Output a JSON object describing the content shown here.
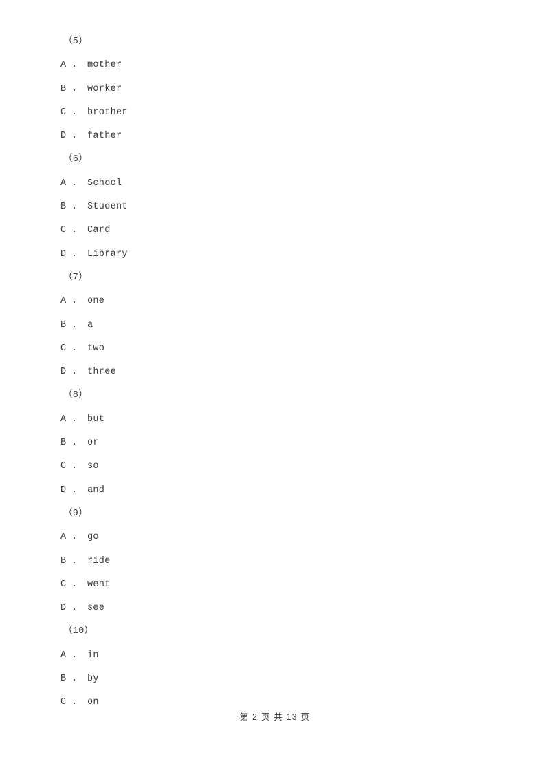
{
  "page": {
    "background_color": "#ffffff",
    "text_color": "#3b3b3b"
  },
  "lines": [
    {
      "type": "qnum",
      "text": "（5）"
    },
    {
      "type": "opt",
      "text": "A ． mother"
    },
    {
      "type": "opt",
      "text": "B ． worker"
    },
    {
      "type": "opt",
      "text": "C ． brother"
    },
    {
      "type": "opt",
      "text": "D ． father"
    },
    {
      "type": "qnum",
      "text": "（6）"
    },
    {
      "type": "opt",
      "text": "A ． School"
    },
    {
      "type": "opt",
      "text": "B ． Student"
    },
    {
      "type": "opt",
      "text": "C ． Card"
    },
    {
      "type": "opt",
      "text": "D ． Library"
    },
    {
      "type": "qnum",
      "text": "（7）"
    },
    {
      "type": "opt",
      "text": "A ． one"
    },
    {
      "type": "opt",
      "text": "B ． a"
    },
    {
      "type": "opt",
      "text": "C ． two"
    },
    {
      "type": "opt",
      "text": "D ． three"
    },
    {
      "type": "qnum",
      "text": "（8）"
    },
    {
      "type": "opt",
      "text": "A ． but"
    },
    {
      "type": "opt",
      "text": "B ． or"
    },
    {
      "type": "opt",
      "text": "C ． so"
    },
    {
      "type": "opt",
      "text": "D ． and"
    },
    {
      "type": "qnum",
      "text": "（9）"
    },
    {
      "type": "opt",
      "text": "A ． go"
    },
    {
      "type": "opt",
      "text": "B ． ride"
    },
    {
      "type": "opt",
      "text": "C ． went"
    },
    {
      "type": "opt",
      "text": "D ． see"
    },
    {
      "type": "qnum",
      "text": "（10）"
    },
    {
      "type": "opt",
      "text": "A ． in"
    },
    {
      "type": "opt",
      "text": "B ． by"
    },
    {
      "type": "opt",
      "text": "C ． on"
    }
  ],
  "footer": {
    "text": "第 2 页 共 13 页",
    "current_page": "2",
    "total_pages": "13"
  }
}
